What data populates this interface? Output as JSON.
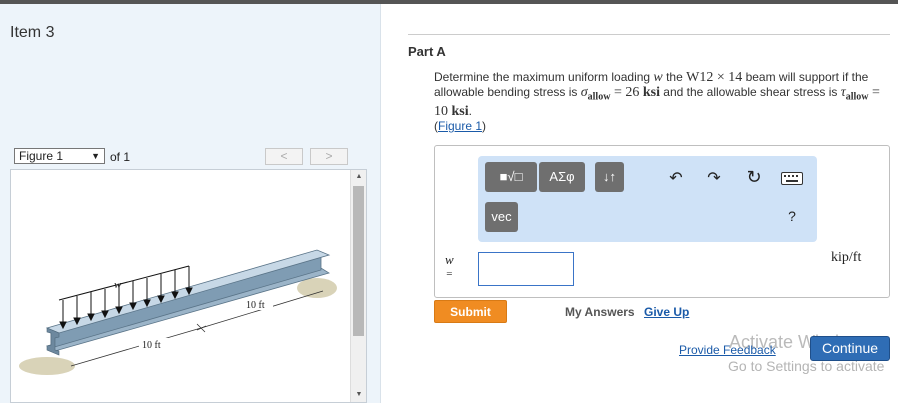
{
  "item_title": "Item 3",
  "figure": {
    "select_value": "Figure 1",
    "of_label": "of 1",
    "prev_label": "<",
    "next_label": ">",
    "load_label": "w",
    "dim_left": "10 ft",
    "dim_right": "10 ft"
  },
  "part": {
    "title": "Part A",
    "text_1": "Determine the maximum uniform loading ",
    "w_symbol": "w",
    "text_2": " the ",
    "beam": "W12",
    "times": "×",
    "beam_num": "14",
    "text_3": " beam will support if the allowable bending stress is ",
    "sigma": "σ",
    "allow_sub": "allow",
    "eq_bend": "= 26 ",
    "ksi_1": "ksi",
    "text_4": " and the allowable shear stress is ",
    "tau": "τ",
    "eq_shear": "= 10 ",
    "ksi_2": "ksi",
    "text_5": ".",
    "fig_link_open": "(",
    "fig_link": "Figure 1",
    "fig_link_close": ")"
  },
  "toolbar": {
    "templates_label": "■√□",
    "greek_label": "ΑΣφ",
    "sort_label": "↓↑",
    "vec_label": "vec",
    "help_label": "?"
  },
  "answer": {
    "variable": "w",
    "equals": "=",
    "value": "",
    "units": "kip/ft"
  },
  "actions": {
    "submit": "Submit",
    "my_answers": "My Answers",
    "give_up": "Give Up",
    "feedback": "Provide Feedback",
    "continue": "Continue"
  },
  "watermark": {
    "line1": "Activate Windows",
    "line2": "Go to Settings to activate"
  },
  "colors": {
    "accent_orange": "#f08c22",
    "accent_blue": "#2f6db5",
    "toolbar_bg": "#cfe2f7",
    "panel_bg": "#edf4fa"
  }
}
